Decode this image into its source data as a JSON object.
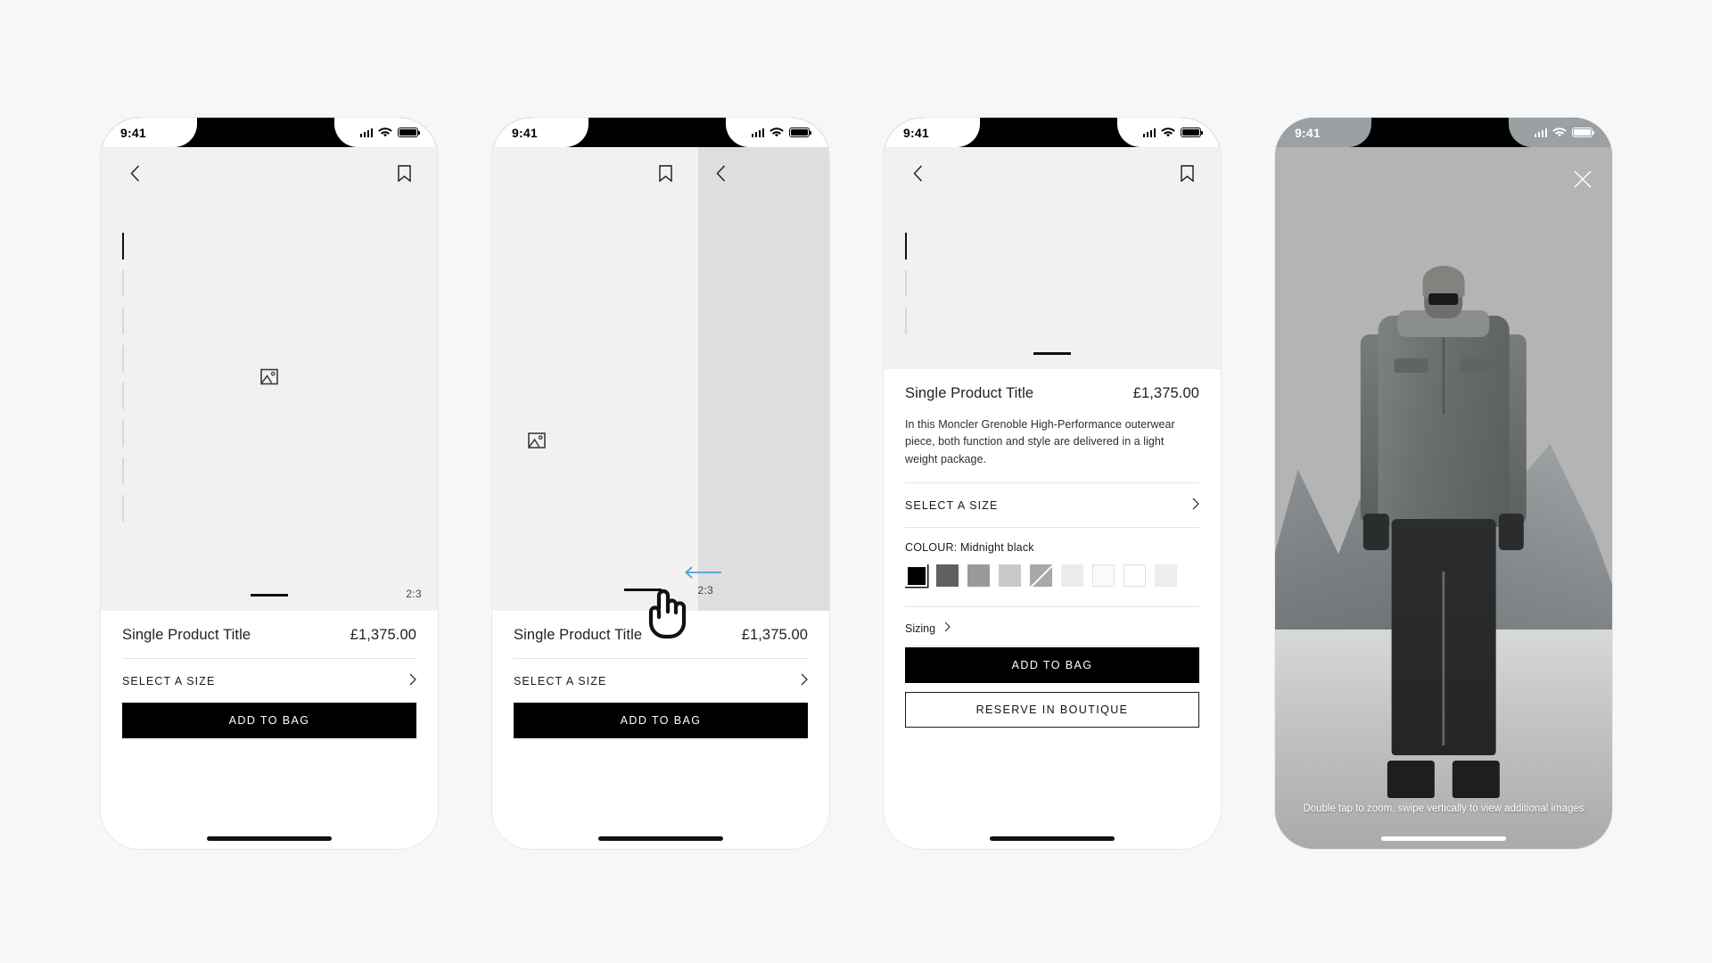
{
  "meta": {
    "background_color": "#f7f7f7",
    "accent_color": "#4a9fd8",
    "primary_button_color": "#000000"
  },
  "status_bar": {
    "time": "9:41",
    "signal_icon": "cellular-signal-icon",
    "wifi_icon": "wifi-icon",
    "battery_icon": "battery-icon"
  },
  "product": {
    "title": "Single Product Title",
    "price": "£1,375.00",
    "description": "In this Moncler Grenoble High-Performance outerwear piece, both function and style are delivered in a light weight package.",
    "select_size_label": "SELECT A SIZE",
    "colour_label": "COLOUR: Midnight black",
    "sizing_label": "Sizing",
    "add_to_bag_label": "ADD TO BAG",
    "reserve_label": "RESERVE IN BOUTIQUE",
    "aspect_ratio_label": "2:3",
    "swatches": [
      {
        "name": "midnight-black",
        "color": "#000000",
        "selected": true,
        "style": "solid"
      },
      {
        "name": "dark-grey",
        "color": "#606060",
        "selected": false,
        "style": "solid"
      },
      {
        "name": "mid-grey",
        "color": "#9a9a9a",
        "selected": false,
        "style": "solid"
      },
      {
        "name": "light-grey",
        "color": "#c9c9c9",
        "selected": false,
        "style": "solid"
      },
      {
        "name": "grey-stripe",
        "color": "#a8a8a8",
        "selected": false,
        "style": "diagonal"
      },
      {
        "name": "pale-grey",
        "color": "#ececec",
        "selected": false,
        "style": "solid"
      },
      {
        "name": "off-white",
        "color": "#fafafa",
        "selected": false,
        "style": "outline"
      },
      {
        "name": "white",
        "color": "#ffffff",
        "selected": false,
        "style": "outline"
      },
      {
        "name": "partial-swatch",
        "color": "#ededed",
        "selected": false,
        "style": "solid"
      }
    ]
  },
  "screens": [
    {
      "id": "pdp-default",
      "name": "product-detail-default",
      "back_icon": "back-chevron-icon",
      "bookmark_icon": "bookmark-icon",
      "placeholder_icon": "image-placeholder-icon",
      "pagination_total": 8,
      "pagination_active": 1
    },
    {
      "id": "pdp-swipe",
      "name": "product-detail-swipe-gesture",
      "back_icon": "back-chevron-icon",
      "bookmark_icon": "bookmark-icon",
      "placeholder_icon": "image-placeholder-icon",
      "gesture_icon": "pointing-hand-cursor-icon",
      "gesture_arrow_icon": "arrow-left-icon"
    },
    {
      "id": "pdp-expanded",
      "name": "product-detail-expanded",
      "back_icon": "back-chevron-icon",
      "bookmark_icon": "bookmark-icon",
      "drag_handle": "sheet-drag-handle",
      "pagination_total": 3,
      "pagination_active": 1
    },
    {
      "id": "photo-fullscreen",
      "name": "fullscreen-image-viewer",
      "close_icon": "close-x-icon",
      "caption": "Double tap to zoom, swipe vertically to view additional images"
    }
  ]
}
